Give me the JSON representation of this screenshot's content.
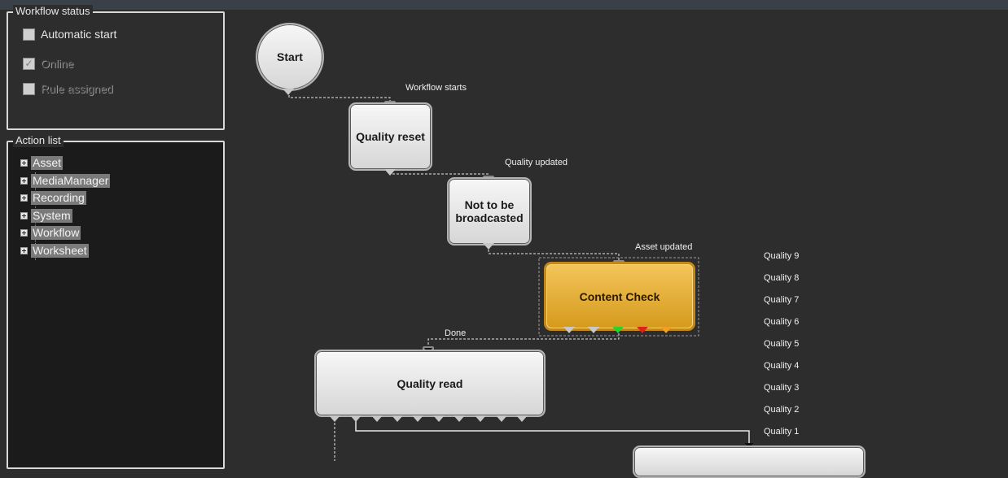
{
  "workflow_status": {
    "title": "Workflow status",
    "checkboxes": [
      {
        "label": "Automatic start",
        "checked": false,
        "enabled": true
      },
      {
        "label": "Online",
        "checked": true,
        "enabled": false
      },
      {
        "label": "Rule assigned",
        "checked": false,
        "enabled": false
      }
    ]
  },
  "action_list": {
    "title": "Action list",
    "items": [
      "Asset",
      "MediaManager",
      "Recording",
      "System",
      "Workflow",
      "Worksheet"
    ]
  },
  "nodes": {
    "start": "Start",
    "quality_reset": "Quality reset",
    "not_broadcasted": "Not to be broadcasted",
    "content_check": "Content Check",
    "quality_read": "Quality read"
  },
  "flow_labels": {
    "workflow_starts": "Workflow starts",
    "quality_updated": "Quality updated",
    "asset_updated": "Asset updated",
    "done": "Done"
  },
  "quality_labels": [
    "Quality 9",
    "Quality 8",
    "Quality 7",
    "Quality 6",
    "Quality 5",
    "Quality 4",
    "Quality 3",
    "Quality 2",
    "Quality 1"
  ],
  "colors": {
    "accent_gold": "#d49a1c",
    "port_green": "#2bd12b",
    "port_red": "#e0201a",
    "port_orange": "#f0a020"
  }
}
